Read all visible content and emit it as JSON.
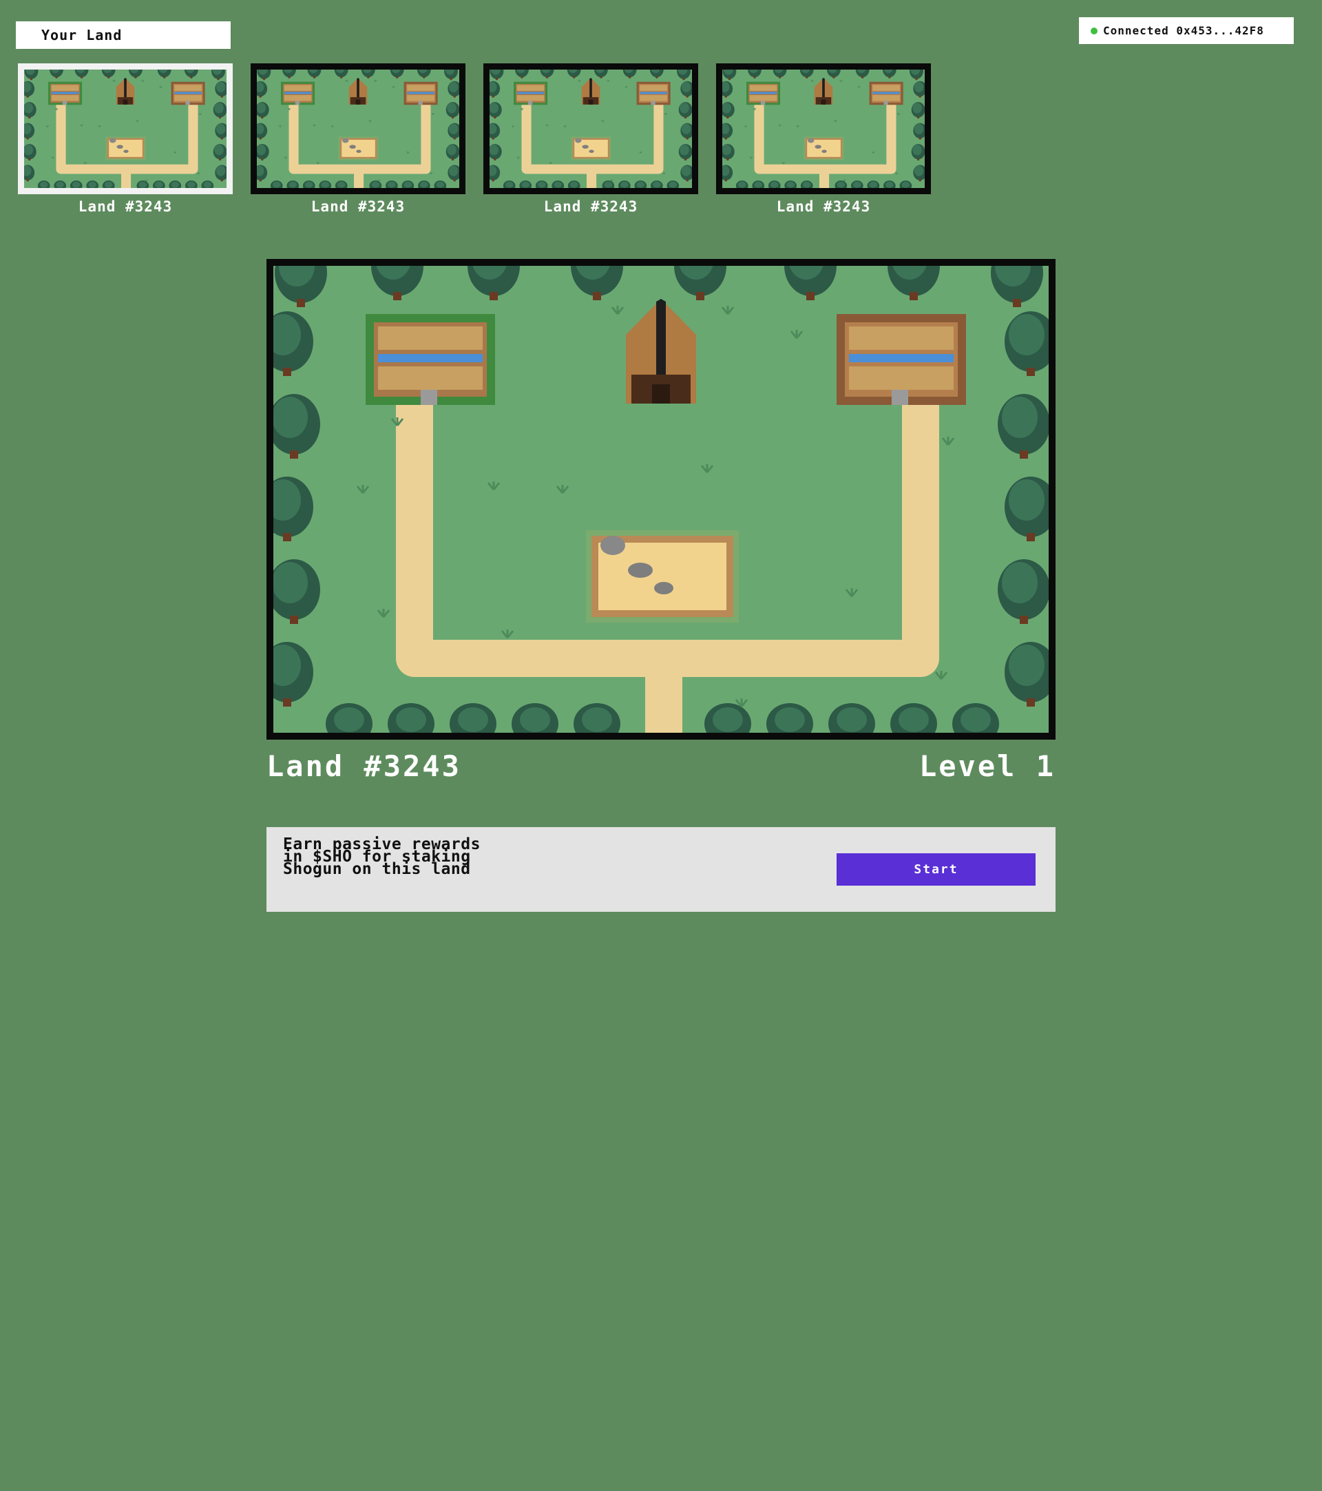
{
  "header": {
    "your_land_label": "Your Land",
    "wallet_status": "Connected 0x453...42F8",
    "status_color": "#3fbf3f"
  },
  "thumbnails": [
    {
      "label": "Land #3243",
      "selected": true
    },
    {
      "label": "Land #3243",
      "selected": false
    },
    {
      "label": "Land #3243",
      "selected": false
    },
    {
      "label": "Land #3243",
      "selected": false
    }
  ],
  "land": {
    "title": "Land #3243",
    "level": "Level 1"
  },
  "staking": {
    "description": "Earn passive rewards in $SHO for staking Shogun on this land",
    "button_label": "Start",
    "button_color": "#5a2fd6"
  },
  "colors": {
    "page_background": "#5e8b5e",
    "grass": "#6aa872",
    "path": "#ecd196",
    "tree_dark": "#2c5a46",
    "frame": "#0a0a0a",
    "selected_frame": "#f2f2f2"
  }
}
